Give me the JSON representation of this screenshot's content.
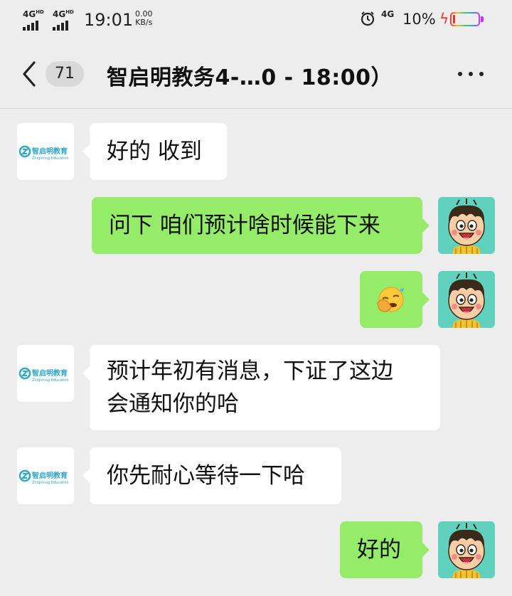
{
  "status_bar": {
    "sim1": "4G",
    "sim1_sup": "HD",
    "sim2": "4G",
    "sim2_sup": "HD",
    "time": "19:01",
    "net_speed_value": "0.00",
    "net_speed_unit": "KB/s",
    "sig_4g": "4G",
    "battery_percent": "10%",
    "battery_level": 0.1,
    "icons": [
      "signal-icon",
      "alarm-icon",
      "charging-icon",
      "battery-icon"
    ]
  },
  "header": {
    "unread_count": "71",
    "title": "智启明教务4-…0 - 18:00）",
    "icons": [
      "back-arrow-icon",
      "more-icon"
    ]
  },
  "org_avatar": {
    "brand_name": "智启明教育",
    "brand_sub": "Zhiqiming Education",
    "brand_color": "#2ea7c9"
  },
  "messages": [
    {
      "side": "in",
      "lines": [
        "好的 收到"
      ]
    },
    {
      "side": "out",
      "lines": [
        "问下 咱们预计啥时候能下来"
      ]
    },
    {
      "side": "out",
      "emoji": "🤦"
    },
    {
      "side": "in",
      "lines": [
        "预计年初有消息，下证了这边",
        "会通知你的哈"
      ]
    },
    {
      "side": "in",
      "lines": [
        "你先耐心等待一下哈"
      ]
    },
    {
      "side": "out",
      "lines": [
        "好的"
      ]
    }
  ],
  "colors": {
    "background": "#ededed",
    "out_bubble": "#95ec69",
    "in_bubble": "#ffffff",
    "user_avatar_bg": "#5fd1bd"
  }
}
